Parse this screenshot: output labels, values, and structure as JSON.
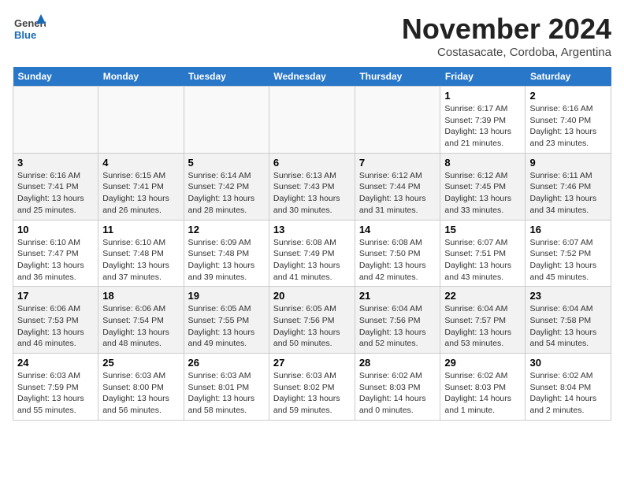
{
  "header": {
    "logo_line1": "General",
    "logo_line2": "Blue",
    "month": "November 2024",
    "location": "Costasacate, Cordoba, Argentina"
  },
  "days_of_week": [
    "Sunday",
    "Monday",
    "Tuesday",
    "Wednesday",
    "Thursday",
    "Friday",
    "Saturday"
  ],
  "weeks": [
    [
      {
        "day": "",
        "info": ""
      },
      {
        "day": "",
        "info": ""
      },
      {
        "day": "",
        "info": ""
      },
      {
        "day": "",
        "info": ""
      },
      {
        "day": "",
        "info": ""
      },
      {
        "day": "1",
        "info": "Sunrise: 6:17 AM\nSunset: 7:39 PM\nDaylight: 13 hours\nand 21 minutes."
      },
      {
        "day": "2",
        "info": "Sunrise: 6:16 AM\nSunset: 7:40 PM\nDaylight: 13 hours\nand 23 minutes."
      }
    ],
    [
      {
        "day": "3",
        "info": "Sunrise: 6:16 AM\nSunset: 7:41 PM\nDaylight: 13 hours\nand 25 minutes."
      },
      {
        "day": "4",
        "info": "Sunrise: 6:15 AM\nSunset: 7:41 PM\nDaylight: 13 hours\nand 26 minutes."
      },
      {
        "day": "5",
        "info": "Sunrise: 6:14 AM\nSunset: 7:42 PM\nDaylight: 13 hours\nand 28 minutes."
      },
      {
        "day": "6",
        "info": "Sunrise: 6:13 AM\nSunset: 7:43 PM\nDaylight: 13 hours\nand 30 minutes."
      },
      {
        "day": "7",
        "info": "Sunrise: 6:12 AM\nSunset: 7:44 PM\nDaylight: 13 hours\nand 31 minutes."
      },
      {
        "day": "8",
        "info": "Sunrise: 6:12 AM\nSunset: 7:45 PM\nDaylight: 13 hours\nand 33 minutes."
      },
      {
        "day": "9",
        "info": "Sunrise: 6:11 AM\nSunset: 7:46 PM\nDaylight: 13 hours\nand 34 minutes."
      }
    ],
    [
      {
        "day": "10",
        "info": "Sunrise: 6:10 AM\nSunset: 7:47 PM\nDaylight: 13 hours\nand 36 minutes."
      },
      {
        "day": "11",
        "info": "Sunrise: 6:10 AM\nSunset: 7:48 PM\nDaylight: 13 hours\nand 37 minutes."
      },
      {
        "day": "12",
        "info": "Sunrise: 6:09 AM\nSunset: 7:48 PM\nDaylight: 13 hours\nand 39 minutes."
      },
      {
        "day": "13",
        "info": "Sunrise: 6:08 AM\nSunset: 7:49 PM\nDaylight: 13 hours\nand 41 minutes."
      },
      {
        "day": "14",
        "info": "Sunrise: 6:08 AM\nSunset: 7:50 PM\nDaylight: 13 hours\nand 42 minutes."
      },
      {
        "day": "15",
        "info": "Sunrise: 6:07 AM\nSunset: 7:51 PM\nDaylight: 13 hours\nand 43 minutes."
      },
      {
        "day": "16",
        "info": "Sunrise: 6:07 AM\nSunset: 7:52 PM\nDaylight: 13 hours\nand 45 minutes."
      }
    ],
    [
      {
        "day": "17",
        "info": "Sunrise: 6:06 AM\nSunset: 7:53 PM\nDaylight: 13 hours\nand 46 minutes."
      },
      {
        "day": "18",
        "info": "Sunrise: 6:06 AM\nSunset: 7:54 PM\nDaylight: 13 hours\nand 48 minutes."
      },
      {
        "day": "19",
        "info": "Sunrise: 6:05 AM\nSunset: 7:55 PM\nDaylight: 13 hours\nand 49 minutes."
      },
      {
        "day": "20",
        "info": "Sunrise: 6:05 AM\nSunset: 7:56 PM\nDaylight: 13 hours\nand 50 minutes."
      },
      {
        "day": "21",
        "info": "Sunrise: 6:04 AM\nSunset: 7:56 PM\nDaylight: 13 hours\nand 52 minutes."
      },
      {
        "day": "22",
        "info": "Sunrise: 6:04 AM\nSunset: 7:57 PM\nDaylight: 13 hours\nand 53 minutes."
      },
      {
        "day": "23",
        "info": "Sunrise: 6:04 AM\nSunset: 7:58 PM\nDaylight: 13 hours\nand 54 minutes."
      }
    ],
    [
      {
        "day": "24",
        "info": "Sunrise: 6:03 AM\nSunset: 7:59 PM\nDaylight: 13 hours\nand 55 minutes."
      },
      {
        "day": "25",
        "info": "Sunrise: 6:03 AM\nSunset: 8:00 PM\nDaylight: 13 hours\nand 56 minutes."
      },
      {
        "day": "26",
        "info": "Sunrise: 6:03 AM\nSunset: 8:01 PM\nDaylight: 13 hours\nand 58 minutes."
      },
      {
        "day": "27",
        "info": "Sunrise: 6:03 AM\nSunset: 8:02 PM\nDaylight: 13 hours\nand 59 minutes."
      },
      {
        "day": "28",
        "info": "Sunrise: 6:02 AM\nSunset: 8:03 PM\nDaylight: 14 hours\nand 0 minutes."
      },
      {
        "day": "29",
        "info": "Sunrise: 6:02 AM\nSunset: 8:03 PM\nDaylight: 14 hours\nand 1 minute."
      },
      {
        "day": "30",
        "info": "Sunrise: 6:02 AM\nSunset: 8:04 PM\nDaylight: 14 hours\nand 2 minutes."
      }
    ]
  ]
}
